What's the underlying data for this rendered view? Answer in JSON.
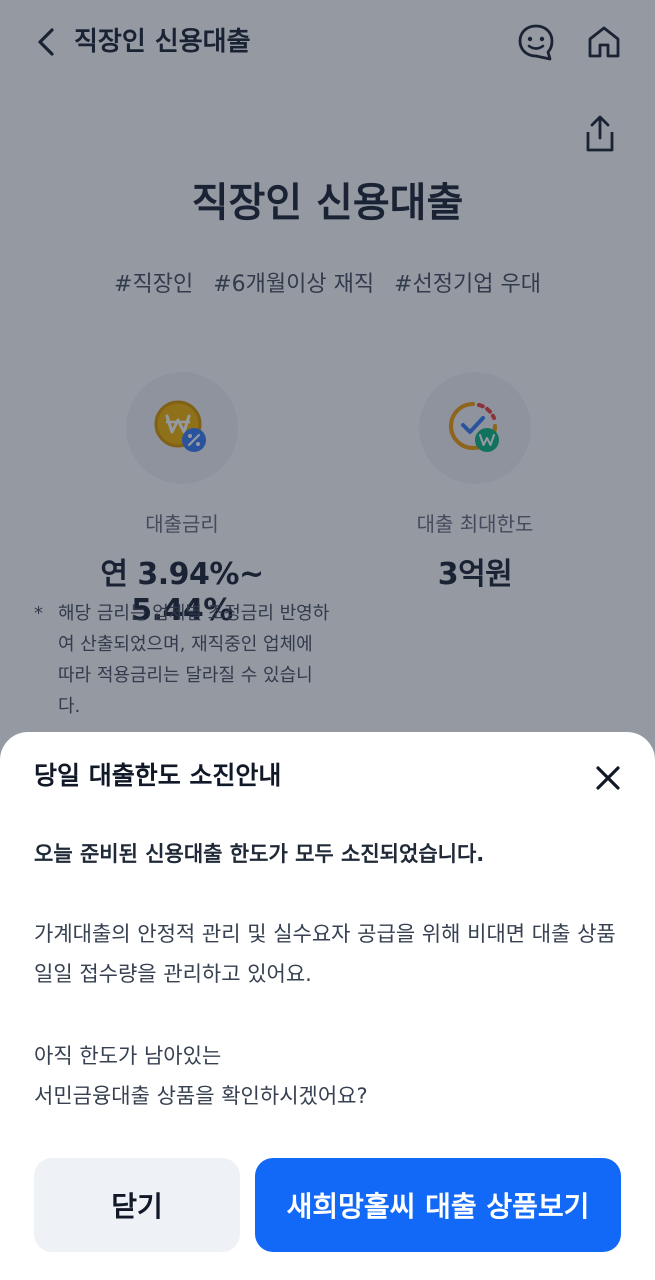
{
  "header": {
    "title": "직장인 신용대출"
  },
  "product": {
    "title": "직장인 신용대출",
    "tags": [
      "#직장인",
      "#6개월이상 재직",
      "#선정기업 우대"
    ],
    "rate": {
      "label": "대출금리",
      "value": "연 3.94%~ 5.44%"
    },
    "limit": {
      "label": "대출 최대한도",
      "value": "3억원"
    },
    "note_star": "*",
    "note": "해당 금리는 업체별 조정금리 반영하여 산출되었으며, 재직중인 업체에 따라 적용금리는 달라질 수 있습니다."
  },
  "sheet": {
    "title": "당일 대출한도 소진안내",
    "lead": "오늘 준비된 신용대출 한도가 모두 소진되었습니다.",
    "para1": "가계대출의 안정적 관리 및 실수요자 공급을 위해 비대면 대출 상품 일일 접수량을 관리하고 있어요.",
    "para2_line1": "아직 한도가 남아있는",
    "para2_line2": "서민금융대출 상품을 확인하시겠어요?",
    "close_label": "닫기",
    "primary_label": "새희망홀씨 대출 상품보기"
  },
  "colors": {
    "primary": "#1268f7",
    "overlay": "rgba(20,28,48,0.45)",
    "gold": "#f2b705"
  }
}
